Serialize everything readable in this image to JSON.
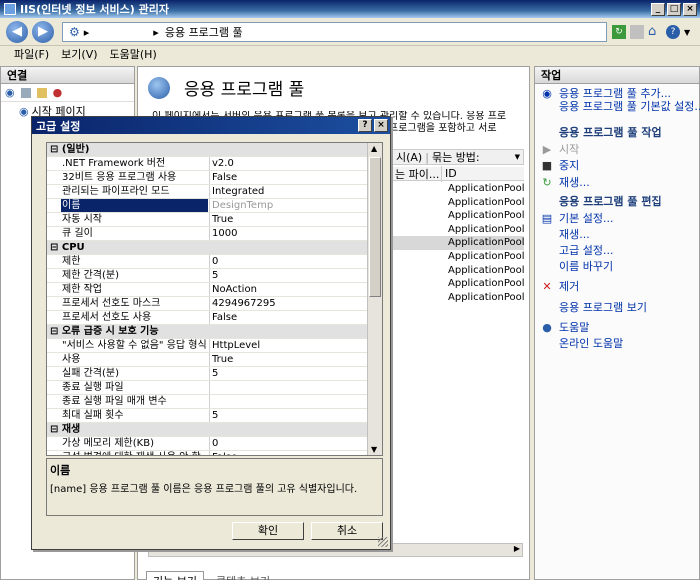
{
  "window": {
    "title": "IIS(인터넷 정보 서비스) 관리자",
    "controls": [
      "_",
      "□",
      "×"
    ]
  },
  "address": {
    "path": "응용 프로그램 풀"
  },
  "menu": [
    "파일(F)",
    "보기(V)",
    "도움말(H)"
  ],
  "connections": {
    "header": "연결",
    "tree": [
      "시작 페이지"
    ]
  },
  "center": {
    "title": "응용 프로그램 풀",
    "desc_line1": "이 페이지에서는 서버의 응용 프로그램 풀 목록을 보고 관리할 수 있습니다. 응용 프로",
    "desc_line2": "그램 풀은 작업자 프로세스에 연결되고 하나 이상의 응용 프로그램을 포함하고 서로",
    "filter_label": "시(A)",
    "group_label": "묶는 방법:",
    "col1": "는 파이...",
    "col2": "ID",
    "rows": [
      "ApplicationPoolI",
      "ApplicationPoolI",
      "ApplicationPoolI",
      "ApplicationPoolI",
      "ApplicationPoolI",
      "ApplicationPoolI",
      "ApplicationPoolI",
      "ApplicationPoolI",
      "ApplicationPoolI"
    ],
    "bottom_tabs": [
      "기능 보기",
      "콘텐츠 보기"
    ]
  },
  "actions": {
    "header": "작업",
    "add": "응용 프로그램 풀 추가...",
    "defaults": "응용 프로그램 풀 기본값 설정...",
    "grp_tasks": "응용 프로그램 풀 작업",
    "start": "시작",
    "stop": "중지",
    "recycle": "재생...",
    "grp_edit": "응용 프로그램 풀 편집",
    "basic": "기본 설정...",
    "recycle2": "재생...",
    "advanced": "고급 설정...",
    "rename": "이름 바꾸기",
    "remove": "제거",
    "view_apps": "응용 프로그램 보기",
    "help": "도움말",
    "online_help": "온라인 도움말"
  },
  "dialog": {
    "title": "고급 설정",
    "help_btn": "?",
    "close_btn": "×",
    "props": [
      {
        "k": "⊟ (일반)",
        "v": "",
        "cat": true
      },
      {
        "k": ".NET Framework 버전",
        "v": "v2.0"
      },
      {
        "k": "32비트 응용 프로그램 사용",
        "v": "False"
      },
      {
        "k": "관리되는 파이프라인 모드",
        "v": "Integrated"
      },
      {
        "k": "이름",
        "v": "DesignTemp",
        "sel": true
      },
      {
        "k": "자동 시작",
        "v": "True"
      },
      {
        "k": "큐 길이",
        "v": "1000"
      },
      {
        "k": "⊟ CPU",
        "v": "",
        "cat": true
      },
      {
        "k": "제한",
        "v": "0"
      },
      {
        "k": "제한 간격(분)",
        "v": "5"
      },
      {
        "k": "제한 작업",
        "v": "NoAction"
      },
      {
        "k": "프로세서 선호도 마스크",
        "v": "4294967295"
      },
      {
        "k": "프로세서 선호도 사용",
        "v": "False"
      },
      {
        "k": "⊟ 오류 급증 시 보호 기능",
        "v": "",
        "cat": true
      },
      {
        "k": "\"서비스 사용할 수 없음\" 응답 형식",
        "v": "HttpLevel"
      },
      {
        "k": "사용",
        "v": "True"
      },
      {
        "k": "실패 간격(분)",
        "v": "5"
      },
      {
        "k": "종료 실행 파일",
        "v": ""
      },
      {
        "k": "종료 실행 파일 매개 변수",
        "v": ""
      },
      {
        "k": "최대 실패 횟수",
        "v": "5"
      },
      {
        "k": "⊟ 재생",
        "v": "",
        "cat": true
      },
      {
        "k": "가상 메모리 제한(KB)",
        "v": "0"
      },
      {
        "k": "구성 변경에 대한 재생 사용 안 함",
        "v": "False"
      }
    ],
    "desc_title": "이름",
    "desc_text": "[name] 응용 프로그램 풀 이름은 응용 프로그램 풀의 고유 식별자입니다.",
    "ok": "확인",
    "cancel": "취소"
  },
  "colors": {
    "title_start": "#0a246a",
    "title_end": "#a6caf0",
    "selection": "#0a246a",
    "link": "#0033aa"
  }
}
